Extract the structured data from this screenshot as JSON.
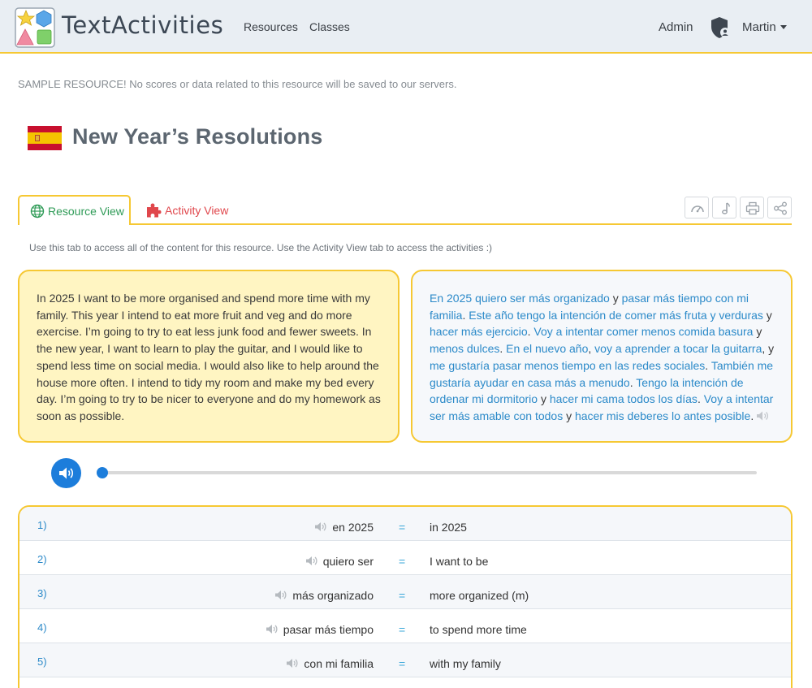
{
  "app": {
    "brand": "TextActivities",
    "nav": {
      "resources": "Resources",
      "classes": "Classes",
      "admin": "Admin",
      "user": "Martin"
    }
  },
  "notice": "SAMPLE RESOURCE! No scores or data related to this resource will be saved to our servers.",
  "resource": {
    "title": "New Year’s Resolutions",
    "flag": "Spain"
  },
  "tabs": {
    "resource_view": "Resource View",
    "activity_view": "Activity View",
    "hint": "Use this tab to access all of the content for this resource. Use the Activity View tab to access the activities :)"
  },
  "toolbar_icons": [
    "gauge-icon",
    "music-note-icon",
    "printer-icon",
    "share-icon"
  ],
  "english_text": "In 2025 I want to be more organised and spend more time with my family. This year I intend to eat more fruit and veg and do more exercise. I’m going to try to eat less junk food and fewer sweets. In the new year, I want to learn to play the guitar, and I would like to spend less time on social media. I would also like to help around the house more often. I intend to tidy my room and make my bed every day. I’m going to try to be nicer to everyone and do my homework as soon as possible.",
  "spanish_segments": [
    {
      "text": "En 2025",
      "phrase": true
    },
    {
      "text": " ",
      "phrase": false
    },
    {
      "text": "quiero ser",
      "phrase": true
    },
    {
      "text": " ",
      "phrase": false
    },
    {
      "text": "más organizado",
      "phrase": true
    },
    {
      "text": " y ",
      "phrase": false
    },
    {
      "text": "pasar más tiempo",
      "phrase": true
    },
    {
      "text": " ",
      "phrase": false
    },
    {
      "text": "con mi familia",
      "phrase": true
    },
    {
      "text": ". ",
      "phrase": false
    },
    {
      "text": "Este año",
      "phrase": true
    },
    {
      "text": " ",
      "phrase": false
    },
    {
      "text": "tengo la intención de",
      "phrase": true
    },
    {
      "text": " ",
      "phrase": false
    },
    {
      "text": "comer más fruta y verduras",
      "phrase": true
    },
    {
      "text": " y ",
      "phrase": false
    },
    {
      "text": "hacer más ejercicio",
      "phrase": true
    },
    {
      "text": ". ",
      "phrase": false
    },
    {
      "text": "Voy a intentar",
      "phrase": true
    },
    {
      "text": " ",
      "phrase": false
    },
    {
      "text": "comer menos comida basura",
      "phrase": true
    },
    {
      "text": " y ",
      "phrase": false
    },
    {
      "text": "menos dulces",
      "phrase": true
    },
    {
      "text": ". ",
      "phrase": false
    },
    {
      "text": "En el nuevo año",
      "phrase": true
    },
    {
      "text": ", ",
      "phrase": false
    },
    {
      "text": "voy a aprender a tocar la guitarra",
      "phrase": true
    },
    {
      "text": ", y ",
      "phrase": false
    },
    {
      "text": "me gustaría pasar menos tiempo en las redes sociales",
      "phrase": true
    },
    {
      "text": ". ",
      "phrase": false
    },
    {
      "text": "También me gustaría ayudar en casa más a menudo",
      "phrase": true
    },
    {
      "text": ". ",
      "phrase": false
    },
    {
      "text": "Tengo la intención de ordenar mi dormitorio",
      "phrase": true
    },
    {
      "text": " y ",
      "phrase": false
    },
    {
      "text": "hacer mi cama todos los días",
      "phrase": true
    },
    {
      "text": ". ",
      "phrase": false
    },
    {
      "text": "Voy a intentar ser más amable con todos",
      "phrase": true
    },
    {
      "text": " y ",
      "phrase": false
    },
    {
      "text": "hacer mis deberes lo antes posible",
      "phrase": true
    },
    {
      "text": ".",
      "phrase": false
    }
  ],
  "audio": {
    "progress": 0
  },
  "vocab": [
    {
      "num": "1)",
      "source": "en 2025",
      "eq": "=",
      "target": "in 2025"
    },
    {
      "num": "2)",
      "source": "quiero ser",
      "eq": "=",
      "target": "I want to be"
    },
    {
      "num": "3)",
      "source": "más organizado",
      "eq": "=",
      "target": "more organized (m)"
    },
    {
      "num": "4)",
      "source": "pasar más tiempo",
      "eq": "=",
      "target": "to spend more time"
    },
    {
      "num": "5)",
      "source": "con mi familia",
      "eq": "=",
      "target": "with my family"
    },
    {
      "num": "",
      "source": "",
      "eq": "",
      "target": ""
    }
  ],
  "colors": {
    "accent_yellow": "#f6c833",
    "link_blue": "#2c8ac9",
    "play_blue": "#1c7ddb",
    "tab_green": "#2f9b57",
    "tab_red": "#e0474c"
  }
}
